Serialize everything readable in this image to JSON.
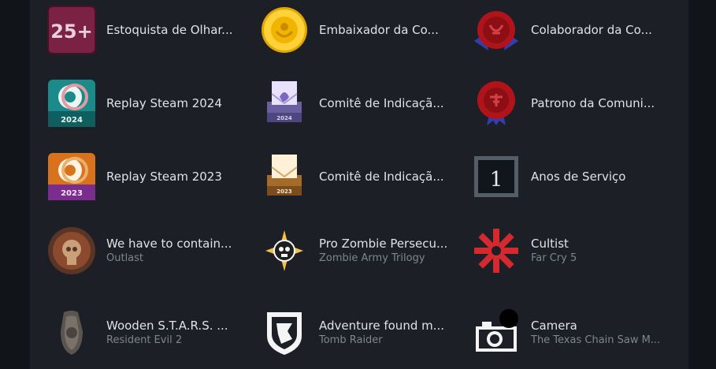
{
  "badges": [
    {
      "name": "Estoquista de Olhar...",
      "sub": "",
      "icon": "twenty-five-plus-icon"
    },
    {
      "name": "Embaixador da Co...",
      "sub": "",
      "icon": "gold-coin-icon"
    },
    {
      "name": "Colaborador da Co...",
      "sub": "",
      "icon": "red-wax-seal-icon"
    },
    {
      "name": "Replay Steam 2024",
      "sub": "",
      "icon": "replay-2024-icon"
    },
    {
      "name": "Comitê de Indicaçã...",
      "sub": "",
      "icon": "envelope-2024-icon"
    },
    {
      "name": "Patrono da Comuni...",
      "sub": "",
      "icon": "red-seal-ribbon-icon"
    },
    {
      "name": "Replay Steam 2023",
      "sub": "",
      "icon": "replay-2023-icon"
    },
    {
      "name": "Comitê de Indicaçã...",
      "sub": "",
      "icon": "envelope-2023-icon"
    },
    {
      "name": "Anos de Serviço",
      "sub": "",
      "icon": "years-of-service-icon",
      "years": "1"
    },
    {
      "name": "We have to contain...",
      "sub": "Outlast",
      "icon": "bronze-medallion-icon"
    },
    {
      "name": "Pro Zombie Persecu...",
      "sub": "Zombie Army Trilogy",
      "icon": "skull-star-icon"
    },
    {
      "name": "Cultist",
      "sub": "Far Cry 5",
      "icon": "cult-cross-icon"
    },
    {
      "name": "Wooden S.T.A.R.S. ...",
      "sub": "Resident Evil 2",
      "icon": "wooden-badge-icon"
    },
    {
      "name": "Adventure found m...",
      "sub": "Tomb Raider",
      "icon": "shield-emblem-icon"
    },
    {
      "name": "Camera",
      "sub": "The Texas Chain Saw M...",
      "icon": "camera-icon"
    }
  ],
  "colors": {
    "page_background": "#111419",
    "panel_background": "#1c2026",
    "title_text": "#dfe3e6",
    "subtitle_text": "#7e858c"
  }
}
